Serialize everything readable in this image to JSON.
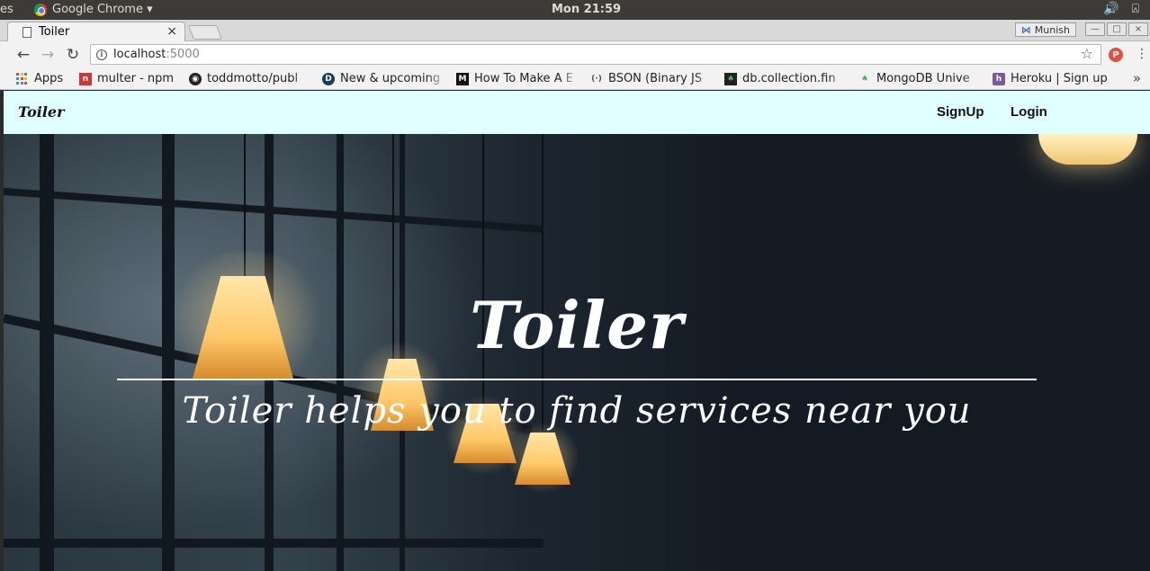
{
  "os": {
    "left_label": "es",
    "app_name": "Google Chrome ▾",
    "clock": "Mon 21:59",
    "tray_icons": [
      "volume-icon",
      "notification-icon"
    ]
  },
  "browser": {
    "tab_title": "Toiler",
    "tab_close": "×",
    "profile_name": "Munish",
    "url_host": "localhost",
    "url_port": ":5000",
    "extension_badge": "P",
    "bookmarks": [
      {
        "label": "Apps",
        "icon": "apps-grid-icon"
      },
      {
        "label": "multer - npm",
        "icon": "npm-icon",
        "color": "#cb3837"
      },
      {
        "label": "toddmotto/publ",
        "icon": "github-icon"
      },
      {
        "label": "New & upcoming",
        "icon": "d-logo-icon"
      },
      {
        "label": "How To Make A E",
        "icon": "medium-icon"
      },
      {
        "label": "BSON (Binary JS",
        "icon": "bson-icon"
      },
      {
        "label": "db.collection.fin",
        "icon": "mongodb-leaf-icon"
      },
      {
        "label": "MongoDB Unive",
        "icon": "mongodb-leaf-icon"
      },
      {
        "label": "Heroku | Sign up",
        "icon": "heroku-icon",
        "color": "#79589f"
      }
    ],
    "bookmarks_more": "»"
  },
  "site": {
    "brand": "Toiler",
    "nav": {
      "signup": "SignUp",
      "login": "Login"
    },
    "hero_title": "Toiler",
    "hero_subtitle": "Toiler helps you to find services near you",
    "navbar_color": "#e0ffff"
  }
}
